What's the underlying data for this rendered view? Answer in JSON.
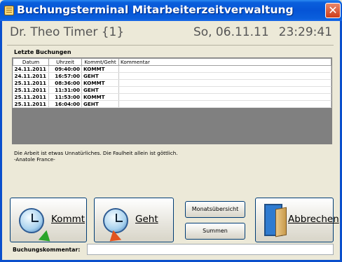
{
  "window": {
    "title": "Buchungsterminal Mitarbeiterzeitverwaltung",
    "close_symbol": "✕"
  },
  "header": {
    "user": "Dr. Theo Timer {1}",
    "date": "So, 06.11.11",
    "time": "23:29:41"
  },
  "bookings": {
    "section_label": "Letzte Buchungen",
    "columns": [
      "Datum",
      "Uhrzeit",
      "Kommt/Geht",
      "Kommentar"
    ],
    "rows": [
      [
        "24.11.2011",
        "09:40:00",
        "KOMMT",
        ""
      ],
      [
        "24.11.2011",
        "16:57:00",
        "GEHT",
        ""
      ],
      [
        "25.11.2011",
        "08:36:00",
        "KOMMT",
        ""
      ],
      [
        "25.11.2011",
        "11:31:00",
        "GEHT",
        ""
      ],
      [
        "25.11.2011",
        "11:53:00",
        "KOMMT",
        ""
      ],
      [
        "25.11.2011",
        "16:04:00",
        "GEHT",
        ""
      ]
    ]
  },
  "quote": {
    "line1": "Die Arbeit ist etwas Unnatürliches. Die Faulheit allein ist göttlich.",
    "line2": "-Anatole France-"
  },
  "buttons": {
    "kommt": "Kommt",
    "geht": "Geht",
    "monats": "Monatsübersicht",
    "summen": "Summen",
    "abbrechen": "Abbrechen"
  },
  "comment": {
    "label": "Buchungskommentar:",
    "value": ""
  },
  "icons": {
    "app": "app-calendar-icon",
    "kommt": "clock-arrow-in-icon",
    "geht": "clock-arrow-out-icon",
    "abbrechen": "door-exit-icon"
  },
  "colors": {
    "titlebar": "#0554d6",
    "window_bg": "#ece9d8",
    "grid_empty": "#808080",
    "close": "#cf3c19"
  }
}
